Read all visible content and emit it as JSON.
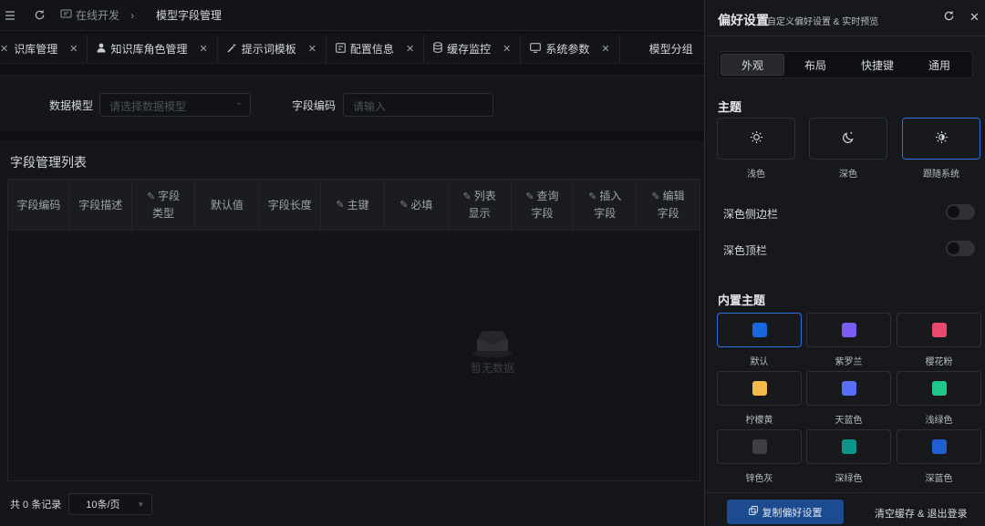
{
  "topbar": {
    "breadcrumb_parent": "在线开发",
    "breadcrumb_current": "模型字段管理"
  },
  "tabs": [
    {
      "label": "识库管理",
      "icon": "book-icon"
    },
    {
      "label": "知识库角色管理",
      "icon": "user-icon"
    },
    {
      "label": "提示词模板",
      "icon": "magic-icon"
    },
    {
      "label": "配置信息",
      "icon": "config-icon"
    },
    {
      "label": "缓存监控",
      "icon": "database-icon"
    },
    {
      "label": "系统参数",
      "icon": "monitor-icon"
    },
    {
      "label": "模型分组",
      "icon": ""
    }
  ],
  "filter": {
    "model_label": "数据模型",
    "model_placeholder": "请选择数据模型",
    "code_label": "字段编码",
    "code_placeholder": "请输入"
  },
  "table": {
    "title": "字段管理列表",
    "columns": [
      {
        "l1": "字段编码",
        "l2": "",
        "edit": false
      },
      {
        "l1": "字段描述",
        "l2": "",
        "edit": false
      },
      {
        "l1": "字段",
        "l2": "类型",
        "edit": true
      },
      {
        "l1": "默认值",
        "l2": "",
        "edit": false
      },
      {
        "l1": "字段长度",
        "l2": "",
        "edit": false
      },
      {
        "l1": "主键",
        "l2": "",
        "edit": true
      },
      {
        "l1": "必填",
        "l2": "",
        "edit": true
      },
      {
        "l1": "列表",
        "l2": "显示",
        "edit": true
      },
      {
        "l1": "查询",
        "l2": "字段",
        "edit": true
      },
      {
        "l1": "插入",
        "l2": "字段",
        "edit": true
      },
      {
        "l1": "编辑",
        "l2": "字段",
        "edit": true
      }
    ],
    "empty_text": "暂无数据",
    "total_text": "共 0 条记录",
    "page_size": "10条/页"
  },
  "drawer": {
    "title": "偏好设置",
    "subtitle": "自定义偏好设置 & 实时预览",
    "segments": [
      "外观",
      "布局",
      "快捷键",
      "通用"
    ],
    "active_segment": "外观",
    "theme_section": "主题",
    "themes": [
      {
        "label": "浅色",
        "icon": "sun-icon"
      },
      {
        "label": "深色",
        "icon": "moon-icon"
      },
      {
        "label": "跟随系统",
        "icon": "auto-theme-icon"
      }
    ],
    "selected_theme": "跟随系统",
    "dark_sidebar_label": "深色侧边栏",
    "dark_sidebar_on": false,
    "dark_header_label": "深色顶栏",
    "dark_header_on": false,
    "builtin_section": "内置主题",
    "builtin_themes": [
      {
        "label": "默认",
        "color": "#1668dc"
      },
      {
        "label": "紫罗兰",
        "color": "#7a5cf0"
      },
      {
        "label": "樱花粉",
        "color": "#e84a6f"
      },
      {
        "label": "柠檬黄",
        "color": "#f2b94b"
      },
      {
        "label": "天蓝色",
        "color": "#5a6ef5"
      },
      {
        "label": "浅绿色",
        "color": "#1fc78a"
      },
      {
        "label": "锌色灰",
        "color": "#3f4045"
      },
      {
        "label": "深绿色",
        "color": "#0d9488"
      },
      {
        "label": "深蓝色",
        "color": "#1f5fd1"
      }
    ],
    "selected_builtin": "默认",
    "copy_button": "复制偏好设置",
    "clear_button": "清空缓存 & 退出登录"
  }
}
